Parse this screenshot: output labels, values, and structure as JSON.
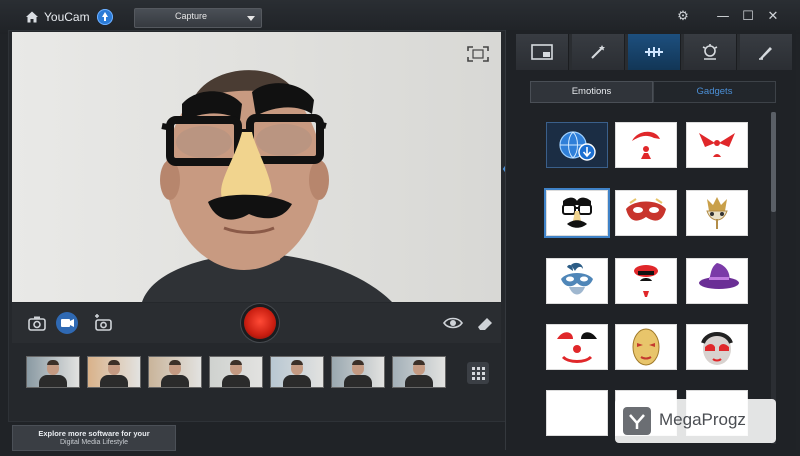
{
  "app": {
    "title": "YouCam"
  },
  "toolbar": {
    "mode": "Capture"
  },
  "window_controls": {
    "settings": "⚙",
    "minimize": "—",
    "maximize": "☐",
    "close": "✕"
  },
  "effects_panel": {
    "tabs": [
      "frames-icon",
      "magic-wand-icon",
      "gadget-icon",
      "avatar-icon",
      "brush-icon"
    ],
    "active_tab": 2,
    "subtabs": {
      "emotions": "Emotions",
      "gadgets": "Gadgets",
      "active": "Gadgets"
    },
    "gallery": [
      "download-more-icon",
      "santa-hat",
      "red-bow-hat",
      "groucho-glasses",
      "venetian-mask-red",
      "jester-mask",
      "feather-mask",
      "red-beret",
      "witch-hat",
      "clown-face",
      "gold-mask",
      "pink-mask"
    ]
  },
  "promo": {
    "line1": "Explore more software for your",
    "line2": "Digital Media Lifestyle"
  },
  "watermark": {
    "text": "MegaProgz"
  },
  "colors": {
    "accent": "#2b7bd6",
    "record": "#e0271a",
    "active_tab": "#1d4f7e"
  }
}
